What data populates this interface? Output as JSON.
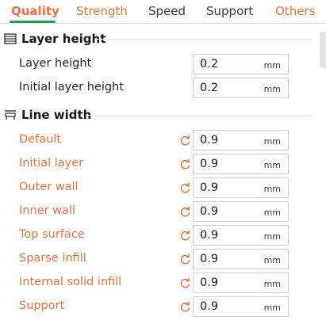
{
  "tabs": [
    {
      "label": "Quality",
      "state": "active"
    },
    {
      "label": "Strength",
      "state": "modified"
    },
    {
      "label": "Speed",
      "state": "normal"
    },
    {
      "label": "Support",
      "state": "normal"
    },
    {
      "label": "Others",
      "state": "modified"
    }
  ],
  "colors": {
    "accent_orange": "#e7733d",
    "active_underline_green": "#14a34a"
  },
  "sections": {
    "layer_height": {
      "title": "Layer height",
      "icon": "layer-stack-icon",
      "rows": [
        {
          "label": "Layer height",
          "value": "0.2",
          "unit": "mm",
          "modified": false
        },
        {
          "label": "Initial layer height",
          "value": "0.2",
          "unit": "mm",
          "modified": false
        }
      ]
    },
    "line_width": {
      "title": "Line width",
      "icon": "line-width-icon",
      "rows": [
        {
          "label": "Default",
          "value": "0.9",
          "unit": "mm",
          "modified": true
        },
        {
          "label": "Initial layer",
          "value": "0.9",
          "unit": "mm",
          "modified": true
        },
        {
          "label": "Outer wall",
          "value": "0.9",
          "unit": "mm",
          "modified": true
        },
        {
          "label": "Inner wall",
          "value": "0.9",
          "unit": "mm",
          "modified": true
        },
        {
          "label": "Top surface",
          "value": "0.9",
          "unit": "mm",
          "modified": true
        },
        {
          "label": "Sparse infill",
          "value": "0.9",
          "unit": "mm",
          "modified": true
        },
        {
          "label": "Internal solid infill",
          "value": "0.9",
          "unit": "mm",
          "modified": true
        },
        {
          "label": "Support",
          "value": "0.9",
          "unit": "mm",
          "modified": true
        }
      ]
    }
  }
}
